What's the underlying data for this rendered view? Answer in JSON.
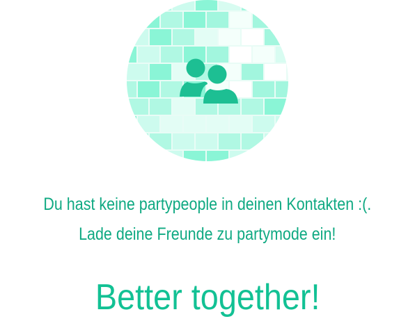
{
  "empty_state": {
    "icon": "disco-ball-contacts-icon",
    "message_line1": "Du hast keine partypeople in deinen Kontakten :(.",
    "message_line2": "Lade deine Freunde zu partymode ein!",
    "tagline": "Better together!"
  },
  "colors": {
    "accent": "#1dbf93",
    "text": "#0fa982",
    "tagline": "#12c194",
    "tile": "#8af5d6"
  }
}
